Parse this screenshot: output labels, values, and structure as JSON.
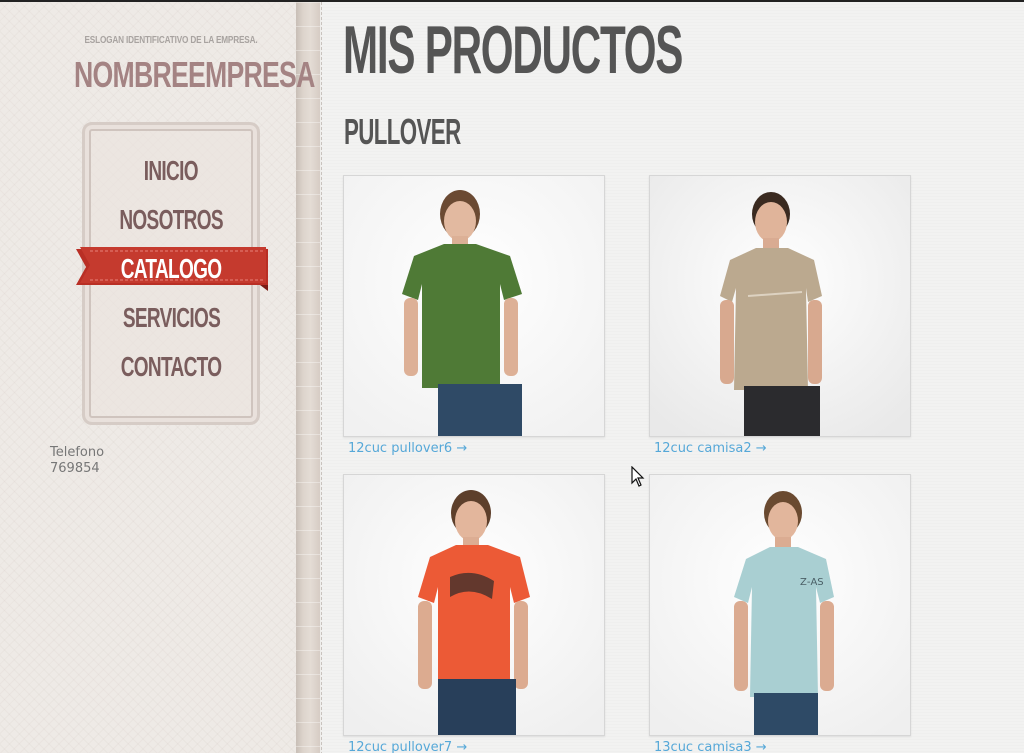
{
  "header": {
    "slogan": "ESLOGAN IDENTIFICATIVO DE LA EMPRESA.",
    "company_name": "NOMBREEMPRESA"
  },
  "nav": {
    "items": [
      {
        "label": "INICIO",
        "active": false
      },
      {
        "label": "NOSOTROS",
        "active": false
      },
      {
        "label": "CATALOGO",
        "active": true
      },
      {
        "label": "SERVICIOS",
        "active": false
      },
      {
        "label": "CONTACTO",
        "active": false
      }
    ],
    "active_color": "#c0362c"
  },
  "contact": {
    "phone_label": "Telefono",
    "phone_number": "769854"
  },
  "main": {
    "page_title": "MIS PRODUCTOS",
    "section_title": "PULLOVER",
    "products": [
      {
        "name": "12cuc pullover6 →",
        "shirt_color": "#4f7a36"
      },
      {
        "name": "12cuc camisa2 →",
        "shirt_color": "#bba98f"
      },
      {
        "name": "12cuc pullover7 →",
        "shirt_color": "#ec5a36"
      },
      {
        "name": "13cuc camisa3 →",
        "shirt_color": "#a9cfd2"
      }
    ]
  },
  "colors": {
    "title_gray": "#555555",
    "company_mauve": "#a48383",
    "link_blue": "#56a8d8"
  }
}
